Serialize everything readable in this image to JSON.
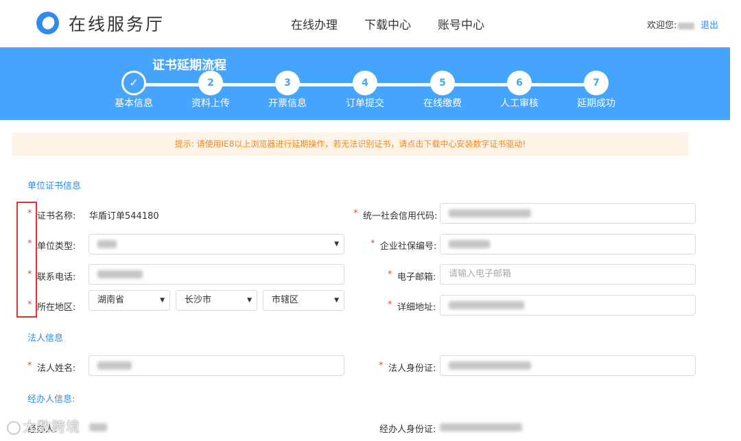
{
  "header": {
    "title": "在线服务厅",
    "nav": [
      "在线办理",
      "下载中心",
      "账号中心"
    ],
    "welcome": "欢迎您:",
    "logout": "退出"
  },
  "process": {
    "title": "证书延期流程",
    "current_step": 1,
    "steps": [
      {
        "num": "✓",
        "label": "基本信息"
      },
      {
        "num": "2",
        "label": "资料上传"
      },
      {
        "num": "3",
        "label": "开票信息"
      },
      {
        "num": "4",
        "label": "订单提交"
      },
      {
        "num": "5",
        "label": "在线缴费"
      },
      {
        "num": "6",
        "label": "人工审核"
      },
      {
        "num": "7",
        "label": "延期成功"
      }
    ]
  },
  "notice": "提示: 请使用IE8以上浏览器进行延期操作，若无法识别证书，请点击下载中心安装数字证书驱动!",
  "cert_section": {
    "title": "单位证书信息",
    "cert_name_label": "证书名称:",
    "cert_name_value": "华盾订单544180",
    "credit_code_label": "统一社会信用代码:",
    "unit_type_label": "单位类型:",
    "social_no_label": "企业社保编号:",
    "phone_label": "联系电话:",
    "email_label": "电子邮箱:",
    "email_placeholder": "请输入电子邮箱",
    "region_label": "所在地区:",
    "province": "湖南省",
    "city": "长沙市",
    "district": "市辖区",
    "address_label": "详细地址:"
  },
  "legal_section": {
    "title": "法人信息",
    "name_label": "法人姓名:",
    "id_label": "法人身份证:"
  },
  "agent_section": {
    "title": "经办人信息:",
    "name_label": "经办人:",
    "id_label": "经办人身份证:"
  },
  "required_mark": "*",
  "watermark": "大数跨境",
  "colors": {
    "banner": "#46a4fc",
    "link": "#2e8cf0",
    "required": "#e74c3c",
    "notice_bg": "#fdf3e6",
    "notice_text": "#f08a24",
    "highlight_box": "#e32f2f"
  }
}
